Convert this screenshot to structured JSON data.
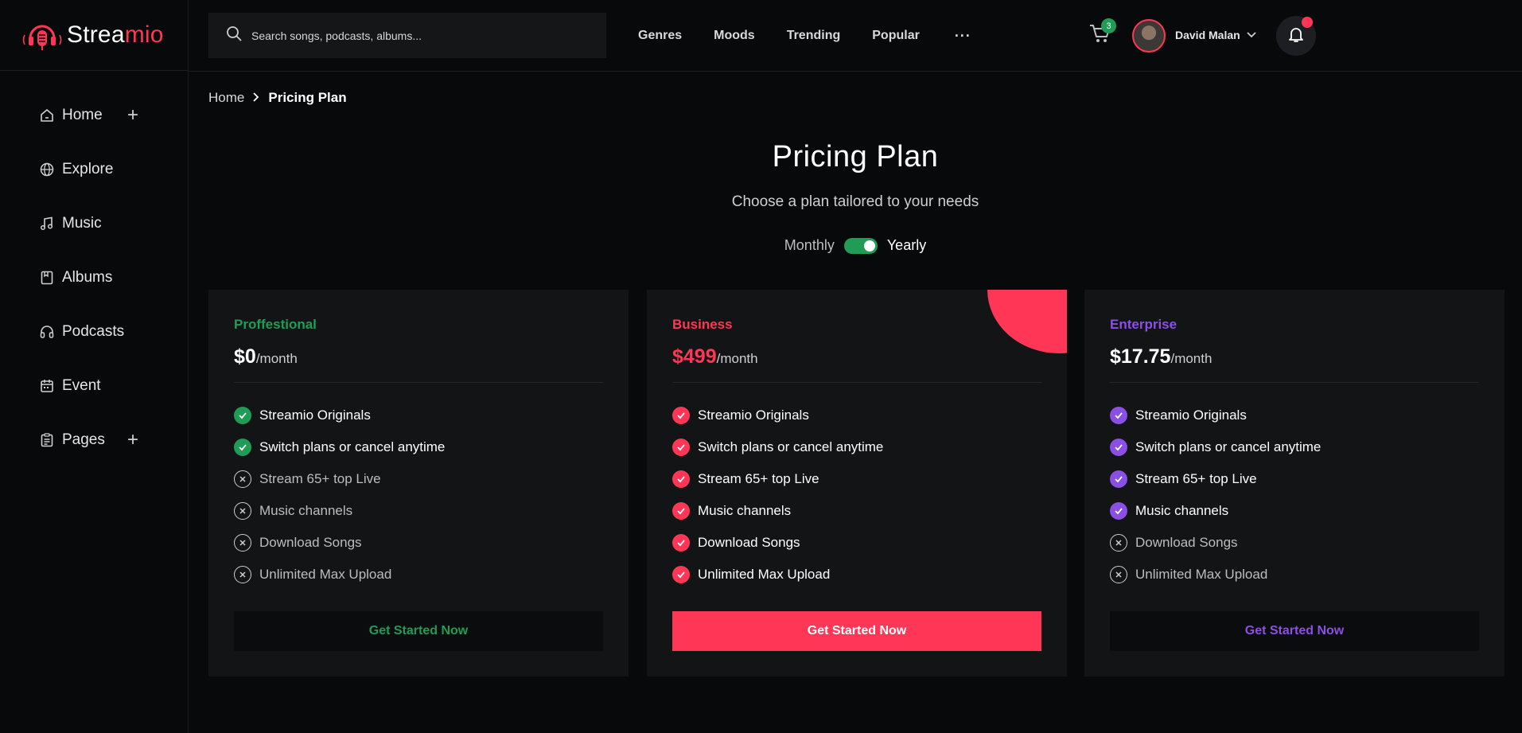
{
  "brand": {
    "name_white": "Strea",
    "name_red": "mio"
  },
  "sidebar": {
    "items": [
      {
        "label": "Home",
        "icon": "home-icon",
        "has_plus": true
      },
      {
        "label": "Explore",
        "icon": "globe-icon",
        "has_plus": false
      },
      {
        "label": "Music",
        "icon": "music-note-icon",
        "has_plus": false
      },
      {
        "label": "Albums",
        "icon": "album-icon",
        "has_plus": false
      },
      {
        "label": "Podcasts",
        "icon": "headphones-icon",
        "has_plus": false
      },
      {
        "label": "Event",
        "icon": "calendar-icon",
        "has_plus": false
      },
      {
        "label": "Pages",
        "icon": "clipboard-icon",
        "has_plus": true
      }
    ]
  },
  "header": {
    "search_placeholder": "Search songs, podcasts, albums...",
    "nav": [
      "Genres",
      "Moods",
      "Trending",
      "Popular"
    ],
    "more": "···",
    "cart_count": "3",
    "user_name": "David Malan"
  },
  "breadcrumb": {
    "home": "Home",
    "current": "Pricing Plan"
  },
  "page": {
    "title": "Pricing Plan",
    "subtitle": "Choose a plan tailored to your needs",
    "toggle_left": "Monthly",
    "toggle_right": "Yearly",
    "toggle_state": "Yearly"
  },
  "colors": {
    "accent_red": "#ff3655",
    "accent_green": "#1f9d57",
    "accent_purple": "#8b4fe6"
  },
  "plans": [
    {
      "name": "Proffestional",
      "price": "$0",
      "per": "/month",
      "cta": "Get Started Now",
      "features": [
        {
          "label": "Streamio Originals",
          "included": true
        },
        {
          "label": "Switch plans or cancel anytime",
          "included": true
        },
        {
          "label": "Stream 65+ top Live",
          "included": false
        },
        {
          "label": "Music channels",
          "included": false
        },
        {
          "label": "Download Songs",
          "included": false
        },
        {
          "label": "Unlimited Max Upload",
          "included": false
        }
      ]
    },
    {
      "name": "Business",
      "price": "$499",
      "per": "/month",
      "cta": "Get Started Now",
      "features": [
        {
          "label": "Streamio Originals",
          "included": true
        },
        {
          "label": "Switch plans or cancel anytime",
          "included": true
        },
        {
          "label": "Stream 65+ top Live",
          "included": true
        },
        {
          "label": "Music channels",
          "included": true
        },
        {
          "label": "Download Songs",
          "included": true
        },
        {
          "label": "Unlimited Max Upload",
          "included": true
        }
      ]
    },
    {
      "name": "Enterprise",
      "price": "$17.75",
      "per": "/month",
      "cta": "Get Started Now",
      "features": [
        {
          "label": "Streamio Originals",
          "included": true
        },
        {
          "label": "Switch plans or cancel anytime",
          "included": true
        },
        {
          "label": "Stream 65+ top Live",
          "included": true
        },
        {
          "label": "Music channels",
          "included": true
        },
        {
          "label": "Download Songs",
          "included": false
        },
        {
          "label": "Unlimited Max Upload",
          "included": false
        }
      ]
    }
  ]
}
